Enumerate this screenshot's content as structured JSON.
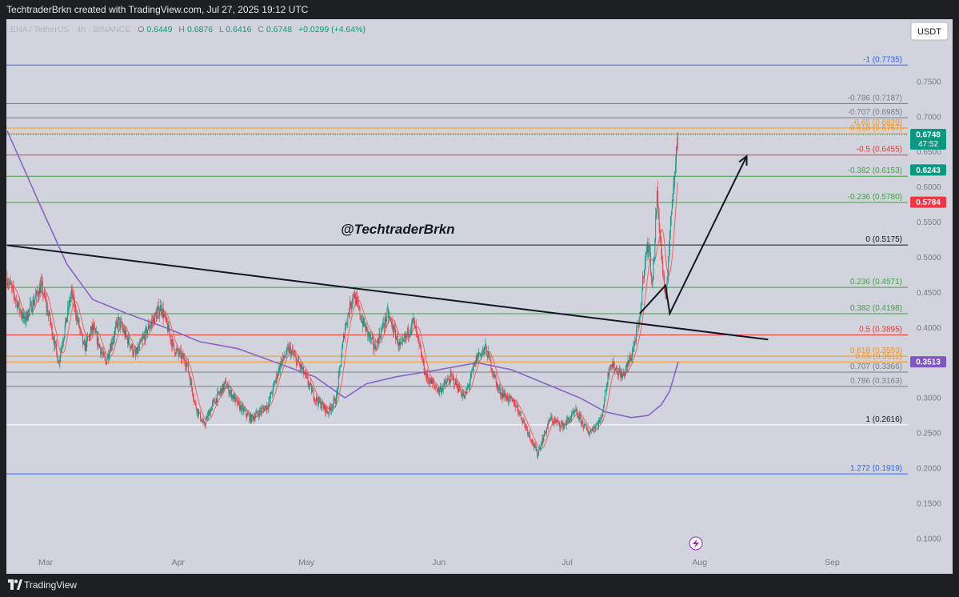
{
  "header": {
    "credit": "TechtraderBrkn created with TradingView.com, Jul 27, 2025 19:12 UTC"
  },
  "legend": {
    "symbol": "ENA / TetherUS · 4h · BINANCE",
    "open_label": "O",
    "open": "0.6449",
    "high_label": "H",
    "high": "0.6876",
    "low_label": "L",
    "low": "0.6416",
    "close_label": "C",
    "close": "0.6748",
    "change": "+0.0299 (+4.64%)"
  },
  "watermark": "@TechtraderBrkn",
  "currency_badge": "USDT",
  "footer": {
    "brand": "TradingView"
  },
  "colors": {
    "bg": "#d1d4dc",
    "up": "#089981",
    "down": "#f23645",
    "ma_long": "#8a63c8",
    "ma_short": "#f06a6a"
  },
  "chart_data": {
    "type": "candlestick",
    "instrument": "ENA / TetherUS",
    "timeframe": "4h",
    "exchange": "BINANCE",
    "x_axis": {
      "ticks": [
        "Mar",
        "Apr",
        "May",
        "Jun",
        "Jul",
        "Aug",
        "Sep"
      ]
    },
    "y_axis": {
      "range": [
        0.085,
        0.8
      ],
      "ticks": [
        "0.7500",
        "0.7000",
        "0.6500",
        "0.6000",
        "0.5500",
        "0.5000",
        "0.4500",
        "0.4000",
        "0.3500",
        "0.3000",
        "0.2500",
        "0.2000",
        "0.1500",
        "0.1000"
      ],
      "tick_values": [
        0.75,
        0.7,
        0.65,
        0.6,
        0.55,
        0.5,
        0.45,
        0.4,
        0.35,
        0.3,
        0.25,
        0.2,
        0.15,
        0.1
      ]
    },
    "price_tags": [
      {
        "text": "0.6748",
        "sub": "47:52",
        "value": 0.6748,
        "color": "#089981"
      },
      {
        "text": "0.6243",
        "value": 0.6243,
        "color": "#089981"
      },
      {
        "text": "0.5784",
        "value": 0.5784,
        "color": "#f23645"
      },
      {
        "text": "0.3513",
        "value": 0.3513,
        "color": "#7e57c2"
      }
    ],
    "fib_levels": [
      {
        "label": "-1 (0.7735)",
        "value": 0.7735,
        "color": "#2962ff"
      },
      {
        "label": "-0.786 (0.7187)",
        "value": 0.7187,
        "color": "#787b86"
      },
      {
        "label": "-0.707 (0.6985)",
        "value": 0.6985,
        "color": "#787b86"
      },
      {
        "label": "-0.65 (0.6839)",
        "value": 0.6839,
        "color": "#f7931a"
      },
      {
        "label": "-0.618 (0.6757)",
        "value": 0.6757,
        "color": "#f7931a"
      },
      {
        "label": "-0.5 (0.6455)",
        "value": 0.6455,
        "color": "#e53935"
      },
      {
        "label": "-0.382 (0.6153)",
        "value": 0.6153,
        "color": "#43a047"
      },
      {
        "label": "-0.236 (0.5780)",
        "value": 0.578,
        "color": "#43a047"
      },
      {
        "label": "0 (0.5175)",
        "value": 0.5175,
        "color": "#131722"
      },
      {
        "label": "0.236 (0.4571)",
        "value": 0.4571,
        "color": "#43a047"
      },
      {
        "label": "0.382 (0.4198)",
        "value": 0.4198,
        "color": "#43a047"
      },
      {
        "label": "0.5 (0.3895)",
        "value": 0.3895,
        "color": "#e53935"
      },
      {
        "label": "0.618 (0.3593)",
        "value": 0.3593,
        "color": "#f7931a"
      },
      {
        "label": "0.65 (0.3511)",
        "value": 0.3511,
        "color": "#f7931a"
      },
      {
        "label": "0.707 (0.3366)",
        "value": 0.3366,
        "color": "#787b86"
      },
      {
        "label": "0.786 (0.3163)",
        "value": 0.3163,
        "color": "#787b86"
      },
      {
        "label": "1 (0.2616)",
        "value": 0.2616,
        "color": "#ffffff"
      },
      {
        "label": "1.272 (0.1919)",
        "value": 0.1919,
        "color": "#2962ff"
      }
    ],
    "price_path": [
      [
        "Feb 20",
        0.47
      ],
      [
        "Feb 24",
        0.41
      ],
      [
        "Feb 28",
        0.46
      ],
      [
        "Mar 2",
        0.41
      ],
      [
        "Mar 4",
        0.35
      ],
      [
        "Mar 7",
        0.45
      ],
      [
        "Mar 10",
        0.37
      ],
      [
        "Mar 12",
        0.4
      ],
      [
        "Mar 15",
        0.35
      ],
      [
        "Mar 18",
        0.41
      ],
      [
        "Mar 22",
        0.36
      ],
      [
        "Mar 25",
        0.4
      ],
      [
        "Mar 28",
        0.43
      ],
      [
        "Mar 31",
        0.37
      ],
      [
        "Apr 3",
        0.35
      ],
      [
        "Apr 5",
        0.29
      ],
      [
        "Apr 7",
        0.26
      ],
      [
        "Apr 9",
        0.29
      ],
      [
        "Apr 12",
        0.32
      ],
      [
        "Apr 15",
        0.29
      ],
      [
        "Apr 18",
        0.27
      ],
      [
        "Apr 22",
        0.29
      ],
      [
        "Apr 25",
        0.35
      ],
      [
        "Apr 27",
        0.37
      ],
      [
        "Apr 30",
        0.34
      ],
      [
        "May 3",
        0.3
      ],
      [
        "May 6",
        0.28
      ],
      [
        "May 8",
        0.3
      ],
      [
        "May 10",
        0.4
      ],
      [
        "May 12",
        0.45
      ],
      [
        "May 14",
        0.41
      ],
      [
        "May 17",
        0.37
      ],
      [
        "May 20",
        0.42
      ],
      [
        "May 23",
        0.37
      ],
      [
        "May 26",
        0.41
      ],
      [
        "May 29",
        0.33
      ],
      [
        "Jun 1",
        0.31
      ],
      [
        "Jun 4",
        0.33
      ],
      [
        "Jun 7",
        0.3
      ],
      [
        "Jun 10",
        0.36
      ],
      [
        "Jun 12",
        0.37
      ],
      [
        "Jun 15",
        0.31
      ],
      [
        "Jun 19",
        0.29
      ],
      [
        "Jun 22",
        0.25
      ],
      [
        "Jun 24",
        0.22
      ],
      [
        "Jun 27",
        0.27
      ],
      [
        "Jun 30",
        0.26
      ],
      [
        "Jul 3",
        0.28
      ],
      [
        "Jul 6",
        0.25
      ],
      [
        "Jul 9",
        0.27
      ],
      [
        "Jul 11",
        0.35
      ],
      [
        "Jul 14",
        0.33
      ],
      [
        "Jul 16",
        0.36
      ],
      [
        "Jul 18",
        0.41
      ],
      [
        "Jul 19",
        0.49
      ],
      [
        "Jul 20",
        0.52
      ],
      [
        "Jul 21",
        0.46
      ],
      [
        "Jul 22",
        0.59
      ],
      [
        "Jul 23",
        0.51
      ],
      [
        "Jul 24",
        0.43
      ],
      [
        "Jul 25",
        0.53
      ],
      [
        "Jul 26",
        0.62
      ],
      [
        "Jul 27",
        0.6748
      ]
    ],
    "ma_long": [
      [
        "Feb 20",
        0.68
      ],
      [
        "Feb 28",
        0.57
      ],
      [
        "Mar 6",
        0.49
      ],
      [
        "Mar 12",
        0.44
      ],
      [
        "Mar 20",
        0.42
      ],
      [
        "Mar 29",
        0.4
      ],
      [
        "Apr 6",
        0.38
      ],
      [
        "Apr 15",
        0.37
      ],
      [
        "Apr 24",
        0.35
      ],
      [
        "May 3",
        0.33
      ],
      [
        "May 10",
        0.3
      ],
      [
        "May 15",
        0.32
      ],
      [
        "May 22",
        0.33
      ],
      [
        "Jun 1",
        0.34
      ],
      [
        "Jun 10",
        0.35
      ],
      [
        "Jun 18",
        0.34
      ],
      [
        "Jun 26",
        0.32
      ],
      [
        "Jul 4",
        0.3
      ],
      [
        "Jul 10",
        0.28
      ],
      [
        "Jul 16",
        0.272
      ],
      [
        "Jul 20",
        0.275
      ],
      [
        "Jul 23",
        0.29
      ],
      [
        "Jul 25",
        0.31
      ],
      [
        "Jul 27",
        0.3513
      ]
    ],
    "drawings": {
      "trendline": [
        [
          "Feb 20",
          0.517
        ],
        [
          "Aug 17",
          0.383
        ]
      ],
      "projection": [
        [
          "Jul 18",
          0.42
        ],
        [
          "Jul 24",
          0.46
        ],
        [
          "Jul 25",
          0.42
        ],
        [
          "Aug 12",
          0.644
        ]
      ]
    }
  }
}
